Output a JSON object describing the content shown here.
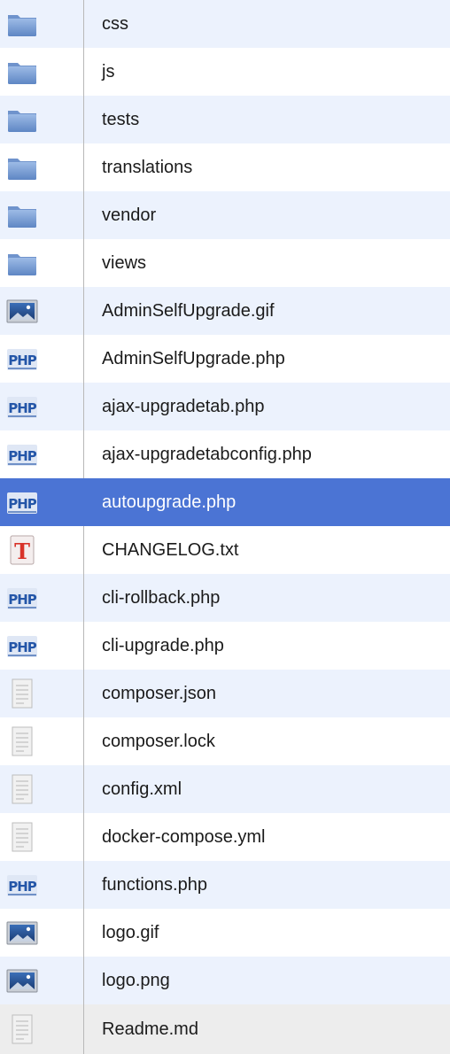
{
  "file_list": {
    "items": [
      {
        "name": "css",
        "type": "folder",
        "icon": "folder-icon"
      },
      {
        "name": "js",
        "type": "folder",
        "icon": "folder-icon"
      },
      {
        "name": "tests",
        "type": "folder",
        "icon": "folder-icon"
      },
      {
        "name": "translations",
        "type": "folder",
        "icon": "folder-icon"
      },
      {
        "name": "vendor",
        "type": "folder",
        "icon": "folder-icon"
      },
      {
        "name": "views",
        "type": "folder",
        "icon": "folder-icon"
      },
      {
        "name": "AdminSelfUpgrade.gif",
        "type": "image",
        "icon": "image-file-icon"
      },
      {
        "name": "AdminSelfUpgrade.php",
        "type": "php",
        "icon": "php-file-icon"
      },
      {
        "name": "ajax-upgradetab.php",
        "type": "php",
        "icon": "php-file-icon"
      },
      {
        "name": "ajax-upgradetabconfig.php",
        "type": "php",
        "icon": "php-file-icon"
      },
      {
        "name": "autoupgrade.php",
        "type": "php",
        "icon": "php-file-icon",
        "selected": true
      },
      {
        "name": "CHANGELOG.txt",
        "type": "text",
        "icon": "text-file-icon"
      },
      {
        "name": "cli-rollback.php",
        "type": "php",
        "icon": "php-file-icon"
      },
      {
        "name": "cli-upgrade.php",
        "type": "php",
        "icon": "php-file-icon"
      },
      {
        "name": "composer.json",
        "type": "generic",
        "icon": "generic-file-icon"
      },
      {
        "name": "composer.lock",
        "type": "generic",
        "icon": "generic-file-icon"
      },
      {
        "name": "config.xml",
        "type": "generic",
        "icon": "generic-file-icon"
      },
      {
        "name": "docker-compose.yml",
        "type": "generic",
        "icon": "generic-file-icon"
      },
      {
        "name": "functions.php",
        "type": "php",
        "icon": "php-file-icon"
      },
      {
        "name": "logo.gif",
        "type": "image",
        "icon": "image-file-icon"
      },
      {
        "name": "logo.png",
        "type": "image",
        "icon": "image-file-icon"
      },
      {
        "name": "Readme.md",
        "type": "generic",
        "icon": "generic-file-icon"
      }
    ]
  },
  "colors": {
    "row_alt": "#ecf2fd",
    "row_plain": "#ffffff",
    "selected": "#4b74d4",
    "folder": "#7ea3d8",
    "php": "#2456a8"
  }
}
